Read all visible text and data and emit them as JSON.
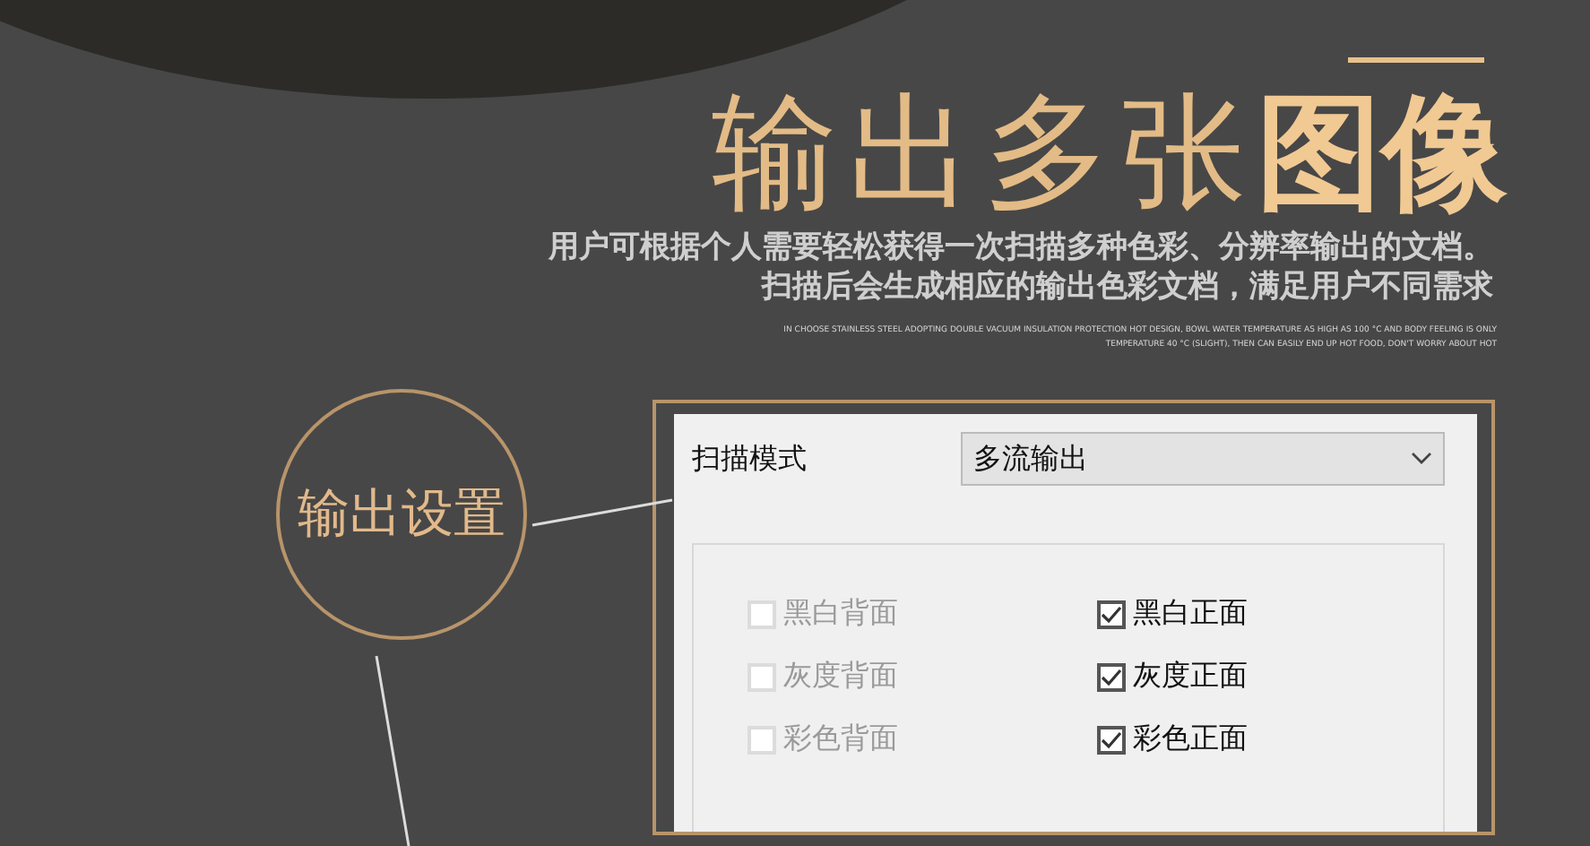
{
  "title": {
    "light": "输出多张",
    "bold": "图像"
  },
  "subtitle": [
    "用户可根据个人需要轻松获得一次扫描多种色彩、分辨率输出的文档。",
    "扫描后会生成相应的输出色彩文档，满足用户不同需求"
  ],
  "fine_print": [
    "IN CHOOSE STAINLESS STEEL ADOPTING DOUBLE VACUUM INSULATION PROTECTION HOT DESIGN, BOWL WATER TEMPERATURE AS HIGH AS 100 °C AND BODY FEELING IS ONLY",
    "TEMPERATURE 40 °C (SLIGHT), THEN CAN EASILY END UP HOT FOOD, DON'T WORRY ABOUT HOT"
  ],
  "callout": {
    "label": "输出设置"
  },
  "dialog": {
    "scan_mode_label": "扫描模式",
    "scan_mode_value": "多流输出",
    "options": [
      {
        "label": "黑白背面",
        "checked": false,
        "disabled": true
      },
      {
        "label": "黑白正面",
        "checked": true,
        "disabled": false
      },
      {
        "label": "灰度背面",
        "checked": false,
        "disabled": true
      },
      {
        "label": "灰度正面",
        "checked": true,
        "disabled": false
      },
      {
        "label": "彩色背面",
        "checked": false,
        "disabled": true
      },
      {
        "label": "彩色正面",
        "checked": true,
        "disabled": false
      }
    ]
  }
}
